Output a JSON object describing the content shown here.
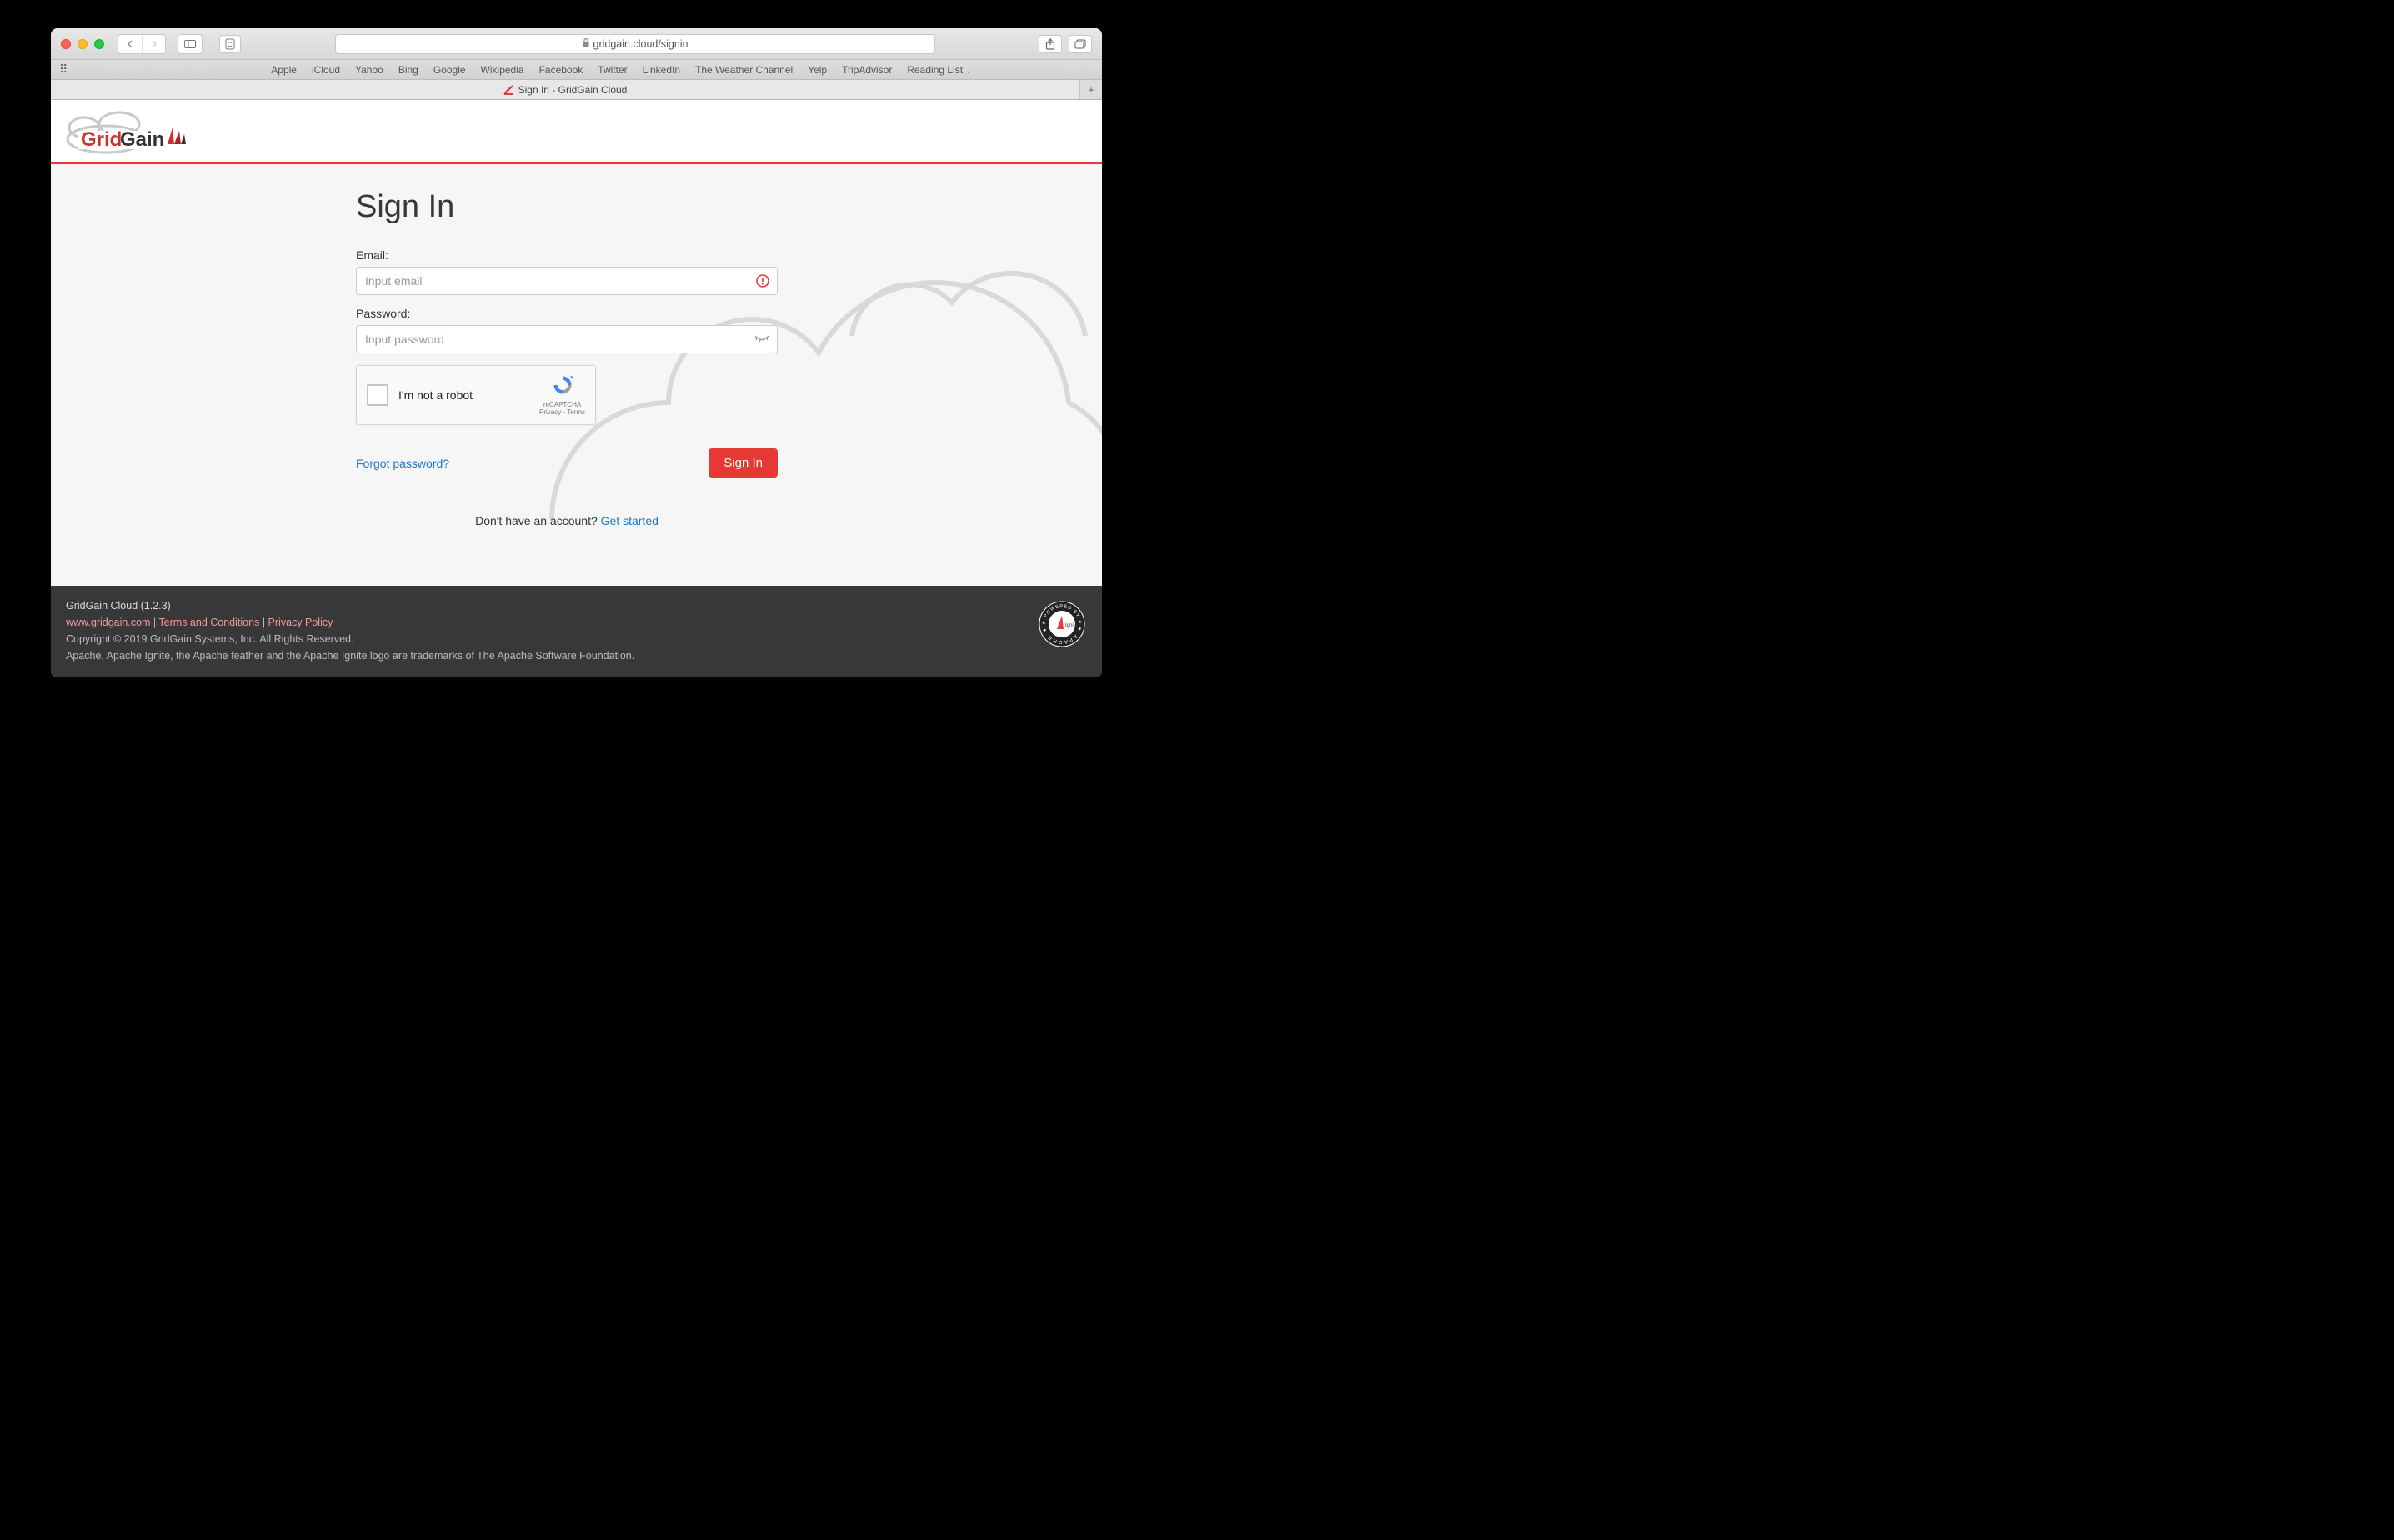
{
  "browser": {
    "url_display": "gridgain.cloud/signin",
    "favorites": [
      "Apple",
      "iCloud",
      "Yahoo",
      "Bing",
      "Google",
      "Wikipedia",
      "Facebook",
      "Twitter",
      "LinkedIn",
      "The Weather Channel",
      "Yelp",
      "TripAdvisor",
      "Reading List"
    ],
    "tab_title": "Sign In - GridGain Cloud"
  },
  "logo": {
    "text1": "Grid",
    "text2": "Gain"
  },
  "signin": {
    "title": "Sign In",
    "email_label": "Email:",
    "email_placeholder": "Input email",
    "password_label": "Password:",
    "password_placeholder": "Input password",
    "recaptcha_label": "I'm not a robot",
    "recaptcha_brand": "reCAPTCHA",
    "recaptcha_links": "Privacy - Terms",
    "forgot_link": "Forgot password?",
    "submit_label": "Sign In",
    "no_account_text": "Don't have an account? ",
    "get_started_link": "Get started"
  },
  "footer": {
    "product_line": "GridGain Cloud (1.2.3)",
    "site_link": "www.gridgain.com",
    "sep": " | ",
    "terms_link": "Terms and Conditions",
    "privacy_link": "Privacy Policy",
    "copyright": "Copyright © 2019 GridGain Systems, Inc. All Rights Reserved.",
    "trademark": "Apache, Apache Ignite, the Apache feather and the Apache Ignite logo are trademarks of The Apache Software Foundation.",
    "badge_top": "POWERED BY",
    "badge_mid": "Ignite",
    "badge_bot": "APACHE"
  }
}
